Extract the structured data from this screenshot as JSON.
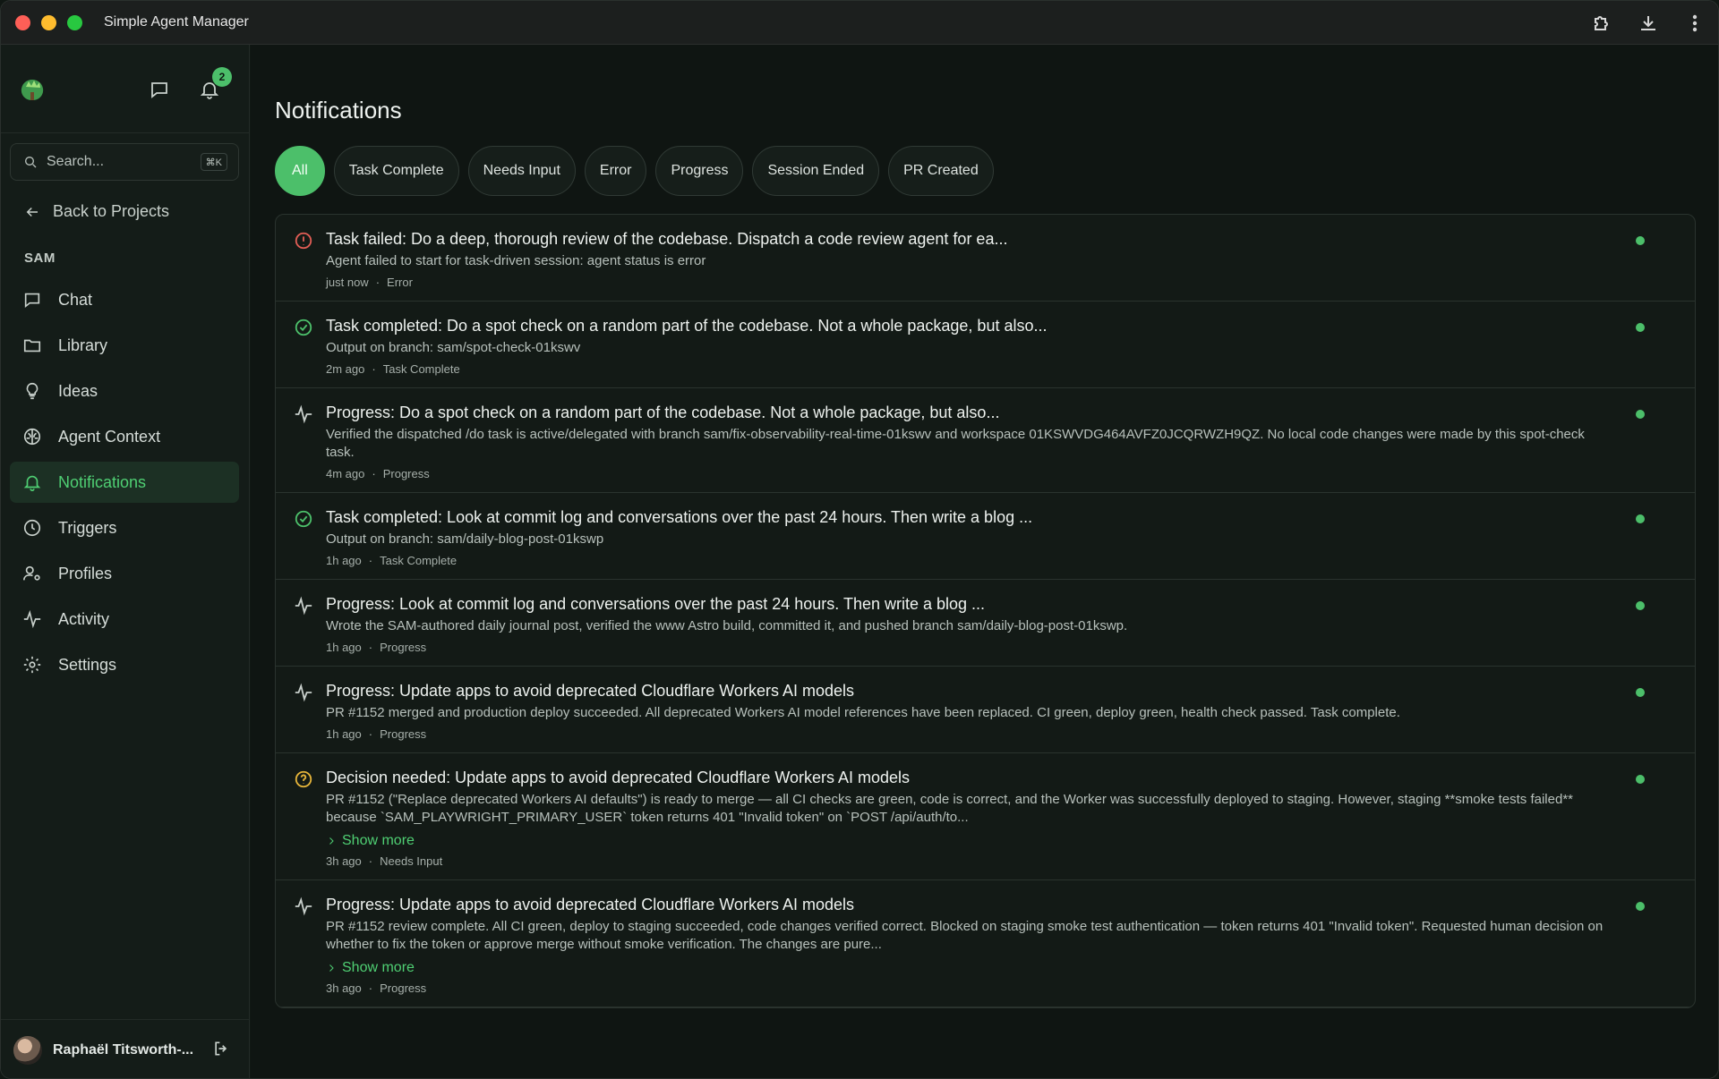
{
  "app": {
    "title": "Simple Agent Manager"
  },
  "sidebar": {
    "notification_count": "2",
    "search_placeholder": "Search...",
    "search_shortcut": "⌘K",
    "back_label": "Back to Projects",
    "section": "SAM",
    "items": [
      {
        "label": "Chat",
        "icon": "chat-icon"
      },
      {
        "label": "Library",
        "icon": "folder-icon"
      },
      {
        "label": "Ideas",
        "icon": "lightbulb-icon"
      },
      {
        "label": "Agent Context",
        "icon": "brain-icon"
      },
      {
        "label": "Notifications",
        "icon": "bell-icon",
        "active": true
      },
      {
        "label": "Triggers",
        "icon": "clock-icon"
      },
      {
        "label": "Profiles",
        "icon": "user-cog-icon"
      },
      {
        "label": "Activity",
        "icon": "activity-icon"
      },
      {
        "label": "Settings",
        "icon": "gear-icon"
      }
    ],
    "user_name": "Raphaël Titsworth-..."
  },
  "main": {
    "title": "Notifications",
    "filters": [
      "All",
      "Task Complete",
      "Needs Input",
      "Error",
      "Progress",
      "Session Ended",
      "PR Created"
    ],
    "active_filter": "All",
    "show_more_label": "Show more",
    "notifications": [
      {
        "kind": "error",
        "title": "Task failed: Do a deep, thorough review of the codebase. Dispatch a code review agent for ea...",
        "body": "Agent failed to start for task-driven session: agent status is error",
        "time": "just now",
        "category": "Error"
      },
      {
        "kind": "complete",
        "title": "Task completed: Do a spot check on a random part of the codebase. Not a whole package, but also...",
        "body": "Output on branch: sam/spot-check-01kswv",
        "time": "2m ago",
        "category": "Task Complete"
      },
      {
        "kind": "progress",
        "title": "Progress: Do a spot check on a random part of the codebase. Not a whole package, but also...",
        "body": "Verified the dispatched /do task is active/delegated with branch sam/fix-observability-real-time-01kswv and workspace 01KSWVDG464AVFZ0JCQRWZH9QZ. No local code changes were made by this spot-check task.",
        "time": "4m ago",
        "category": "Progress"
      },
      {
        "kind": "complete",
        "title": "Task completed: Look at commit log and conversations over the past 24 hours. Then write a blog ...",
        "body": "Output on branch: sam/daily-blog-post-01kswp",
        "time": "1h ago",
        "category": "Task Complete"
      },
      {
        "kind": "progress",
        "title": "Progress: Look at commit log and conversations over the past 24 hours. Then write a blog ...",
        "body": "Wrote the SAM-authored daily journal post, verified the www Astro build, committed it, and pushed branch sam/daily-blog-post-01kswp.",
        "time": "1h ago",
        "category": "Progress"
      },
      {
        "kind": "progress",
        "title": "Progress: Update apps to avoid deprecated Cloudflare Workers AI models",
        "body": "PR #1152 merged and production deploy succeeded. All deprecated Workers AI model references have been replaced. CI green, deploy green, health check passed. Task complete.",
        "time": "1h ago",
        "category": "Progress"
      },
      {
        "kind": "input",
        "title": "Decision needed: Update apps to avoid deprecated Cloudflare Workers AI models",
        "body": "PR #1152 (\"Replace deprecated Workers AI defaults\") is ready to merge — all CI checks are green, code is correct, and the Worker was successfully deployed to staging. However, staging **smoke tests failed** because `SAM_PLAYWRIGHT_PRIMARY_USER` token returns 401 \"Invalid token\" on `POST /api/auth/to...",
        "show_more": true,
        "time": "3h ago",
        "category": "Needs Input"
      },
      {
        "kind": "progress",
        "title": "Progress: Update apps to avoid deprecated Cloudflare Workers AI models",
        "body": "PR #1152 review complete. All CI green, deploy to staging succeeded, code changes verified correct. Blocked on staging smoke test authentication — token returns 401 \"Invalid token\". Requested human decision on whether to fix the token or approve merge without smoke verification. The changes are pure...",
        "show_more": true,
        "time": "3h ago",
        "category": "Progress"
      }
    ]
  }
}
